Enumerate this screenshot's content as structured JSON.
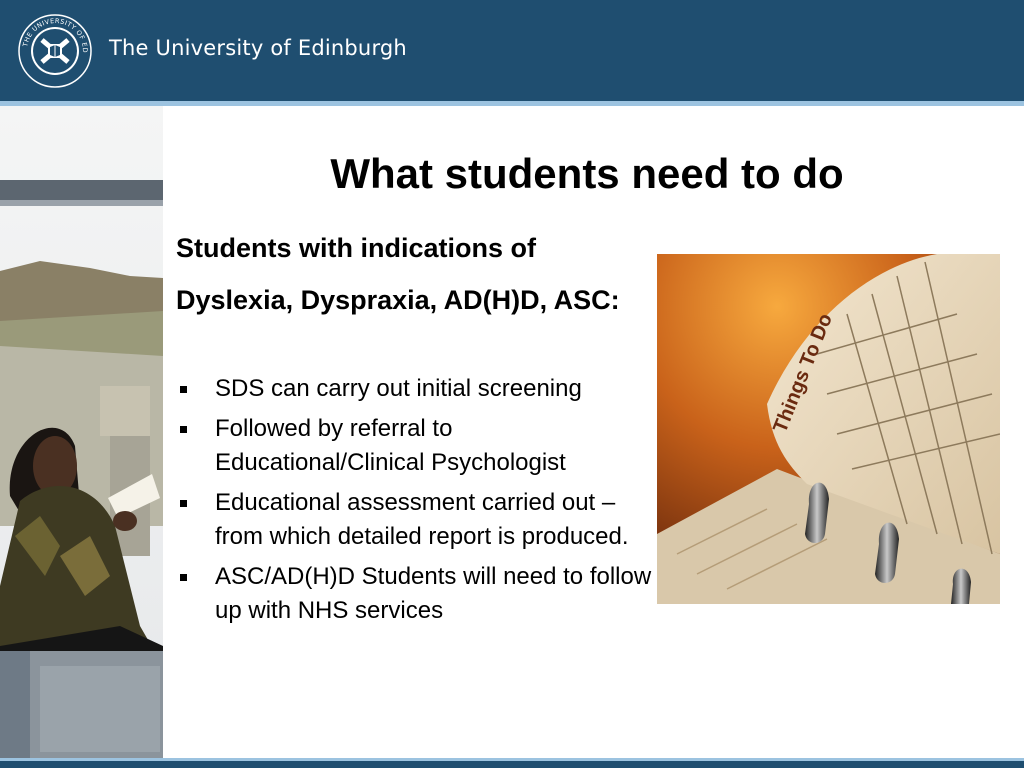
{
  "header": {
    "university_name": "The University of Edinburgh",
    "crest_text": "THE UNIVERSITY OF EDINBURGH",
    "colors": {
      "bar": "#1f4e70",
      "stripe": "#9cc3e0"
    }
  },
  "slide": {
    "title": "What students need to do",
    "intro_line1": "Students with indications of",
    "intro_line2": "Dyslexia, Dyspraxia, AD(H)D, ASC:",
    "bullets": [
      "SDS can carry out initial screening",
      "Followed by referral to Educational/Clinical Psychologist",
      "Educational assessment carried out – from which detailed report is produced.",
      "ASC/AD(H)D Students will need to follow up with NHS services"
    ]
  },
  "images": {
    "todo_caption": "Things To Do"
  }
}
